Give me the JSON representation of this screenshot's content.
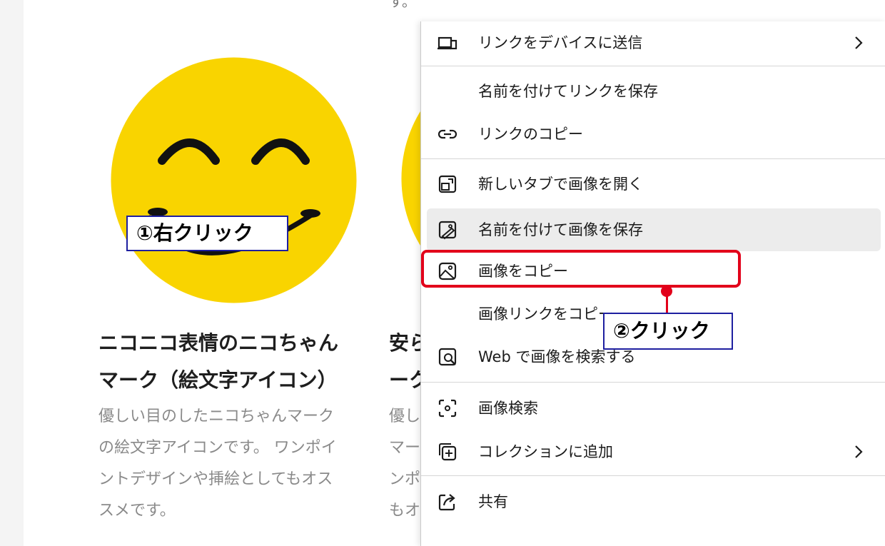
{
  "page": {
    "top_fragment": "す。",
    "cards": [
      {
        "title_line1": "ニコニコ表情のニコちゃん",
        "title_line2": "マーク（絵文字アイコン）",
        "desc_lines": [
          "優しい目のしたニコちゃんマーク",
          "の絵文字アイコンです。 ワンポイ",
          "ントデザインや挿絵としてもオス",
          "スメです。"
        ]
      },
      {
        "title_line1": "安ら",
        "title_line2": "ーク",
        "desc_lines": [
          "優し",
          "マー",
          "ンポ",
          "もオ"
        ]
      }
    ]
  },
  "context_menu": {
    "items": [
      {
        "label": "リンクをデバイスに送信",
        "icon": "device-send-icon",
        "submenu": true
      },
      {
        "label": "名前を付けてリンクを保存",
        "icon": ""
      },
      {
        "label": "リンクのコピー",
        "icon": "link-icon"
      },
      {
        "label": "新しいタブで画像を開く",
        "icon": "open-image-tab-icon"
      },
      {
        "label": "名前を付けて画像を保存",
        "icon": "save-image-icon",
        "hover": true
      },
      {
        "label": "画像をコピー",
        "icon": "image-icon",
        "highlighted": true
      },
      {
        "label": "画像リンクをコピー",
        "icon": ""
      },
      {
        "label": "Web で画像を検索する",
        "icon": "image-search-icon"
      },
      {
        "label": "画像検索",
        "icon": "visual-search-icon"
      },
      {
        "label": "コレクションに追加",
        "icon": "collection-add-icon",
        "submenu": true
      },
      {
        "label": "共有",
        "icon": "share-icon"
      }
    ]
  },
  "annotations": {
    "step1": "①右クリック",
    "step2": "②クリック",
    "highlight_color": "#e2001a",
    "box_border_color": "#1e1fa0"
  },
  "colors": {
    "smiley_yellow": "#f9d400",
    "menu_hover": "#ececec"
  }
}
